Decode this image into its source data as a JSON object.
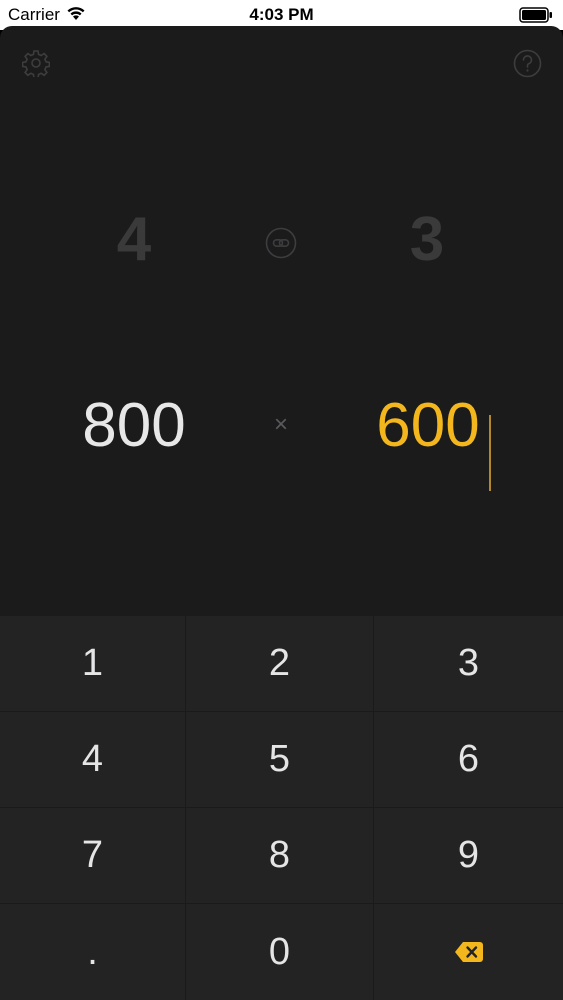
{
  "status_bar": {
    "carrier": "Carrier",
    "time": "4:03 PM",
    "icons": [
      "wifi-icon",
      "battery-icon"
    ]
  },
  "toolbar": {
    "left_icon": "gear-icon",
    "right_icon": "help-circle-icon"
  },
  "ratio": {
    "width": "4",
    "height": "3",
    "link_icon": "link-icon"
  },
  "dimensions": {
    "width": "800",
    "separator": "×",
    "height": "600",
    "active_field": "height"
  },
  "keypad": {
    "keys": [
      "1",
      "2",
      "3",
      "4",
      "5",
      "6",
      "7",
      "8",
      "9",
      ".",
      "0"
    ],
    "delete_icon": "backspace-icon"
  },
  "colors": {
    "background": "#1b1b1c",
    "keypad": "#232324",
    "accent": "#f3b61c",
    "ratio_text": "#3a3a3b",
    "value_text": "#e7e7e8"
  }
}
